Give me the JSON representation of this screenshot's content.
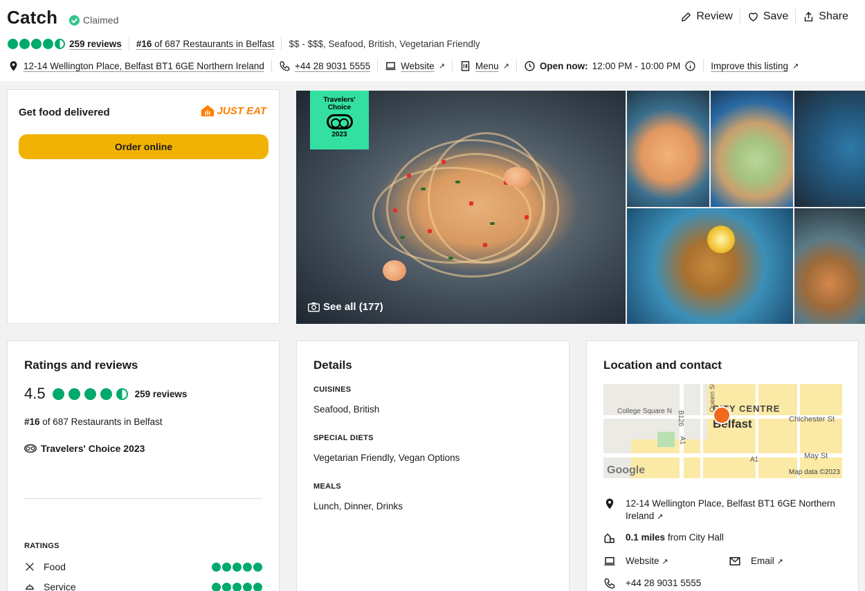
{
  "header": {
    "title": "Catch",
    "claimed": "Claimed",
    "actions": {
      "review": "Review",
      "save": "Save",
      "share": "Share"
    },
    "rating_reviews": "259 reviews",
    "rank_num": "#16",
    "rank_text": "of 687 Restaurants in Belfast",
    "price_cuisines": "$$ - $$$, Seafood, British, Vegetarian Friendly",
    "address": "12-14 Wellington Place, Belfast BT1 6GE Northern Ireland",
    "phone": "+44 28 9031 5555",
    "website": "Website",
    "menu": "Menu",
    "open_label": "Open now:",
    "open_hours": "12:00 PM - 10:00 PM",
    "improve": "Improve this listing",
    "rating_value": 4.5
  },
  "delivery": {
    "label": "Get food delivered",
    "partner": "JUST EAT",
    "button": "Order online"
  },
  "photos": {
    "badge_line1": "Travelers'",
    "badge_line2": "Choice",
    "badge_year": "2023",
    "see_all": "See all (177)"
  },
  "ratings": {
    "heading": "Ratings and reviews",
    "score": "4.5",
    "reviews": "259 reviews",
    "rank_num": "#16",
    "rank_text": "of 687 Restaurants in Belfast",
    "travelers_choice": "Travelers' Choice 2023",
    "ratings_label": "RATINGS",
    "items": [
      {
        "label": "Food",
        "value": 5
      },
      {
        "label": "Service",
        "value": 5
      }
    ]
  },
  "details": {
    "heading": "Details",
    "sections": [
      {
        "title": "CUISINES",
        "value": "Seafood, British"
      },
      {
        "title": "SPECIAL DIETS",
        "value": "Vegetarian Friendly, Vegan Options"
      },
      {
        "title": "MEALS",
        "value": "Lunch, Dinner, Drinks"
      }
    ]
  },
  "location": {
    "heading": "Location and contact",
    "map": {
      "city_centre": "CITY CENTRE",
      "belfast": "Belfast",
      "college": "College Square N",
      "queen": "Queen St",
      "chichester": "Chichester St",
      "b126": "B126",
      "a1": "A1",
      "a1b": "A1",
      "may": "May St",
      "google": "Google",
      "mapdata": "Map data ©2023"
    },
    "address_line1": "12-14 Wellington Place, Belfast BT1 6GE Northern",
    "address_line2": "Ireland",
    "distance_bold": "0.1 miles",
    "distance_rest": "from City Hall",
    "website": "Website",
    "email": "Email",
    "phone": "+44 28 9031 5555"
  },
  "colors": {
    "brand_green": "#00aa6c",
    "order_button": "#f2b203",
    "just_eat": "#ff8000",
    "badge_green": "#34e0a1"
  }
}
